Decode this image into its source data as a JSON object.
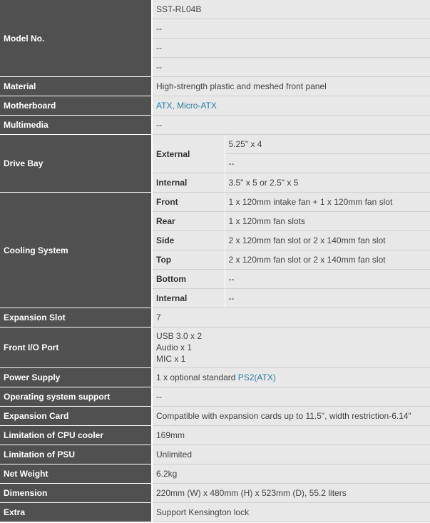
{
  "model": {
    "label": "Model No.",
    "values": [
      "SST-RL04B",
      "--",
      "--",
      "--"
    ]
  },
  "material": {
    "label": "Material",
    "value": "High-strength plastic and meshed front panel"
  },
  "motherboard": {
    "label": "Motherboard",
    "value": "ATX, Micro-ATX"
  },
  "multimedia": {
    "label": "Multimedia",
    "value": "--"
  },
  "drive_bay": {
    "label": "Drive Bay",
    "external_label": "External",
    "external_values": [
      "5.25\" x 4",
      "--"
    ],
    "internal_label": "Internal",
    "internal_value": "3.5\" x 5 or 2.5\" x 5"
  },
  "cooling": {
    "label": "Cooling System",
    "rows": [
      {
        "name": "Front",
        "value": "1 x 120mm intake fan + 1 x 120mm fan slot"
      },
      {
        "name": "Rear",
        "value": "1 x 120mm fan slots"
      },
      {
        "name": "Side",
        "value": "2 x 120mm fan slot or 2 x 140mm fan slot"
      },
      {
        "name": "Top",
        "value": "2 x 120mm fan slot or 2 x 140mm fan slot"
      },
      {
        "name": "Bottom",
        "value": "--"
      },
      {
        "name": "Internal",
        "value": "--"
      }
    ]
  },
  "expansion_slot": {
    "label": "Expansion Slot",
    "value": "7"
  },
  "front_io": {
    "label": "Front I/O Port",
    "lines": [
      "USB 3.0 x 2",
      "Audio x 1",
      "MIC x 1"
    ]
  },
  "power_supply": {
    "label": "Power Supply",
    "prefix": "1 x optional standard ",
    "link": "PS2(ATX)"
  },
  "os_support": {
    "label": "Operating system support",
    "value": "--"
  },
  "expansion_card": {
    "label": "Expansion Card",
    "value": "Compatible with expansion cards up to 11.5\", width restriction-6.14\""
  },
  "cpu_cooler": {
    "label": "Limitation of CPU cooler",
    "value": "169mm"
  },
  "psu_limit": {
    "label": "Limitation of PSU",
    "value": "Unlimited"
  },
  "net_weight": {
    "label": "Net Weight",
    "value": "6.2kg"
  },
  "dimension": {
    "label": "Dimension",
    "value": "220mm (W) x 480mm (H) x 523mm (D), 55.2 liters"
  },
  "extra": {
    "label": "Extra",
    "value": "Support Kensington lock"
  },
  "colors": {
    "header_bg": "#505050",
    "value_bg": "#e8e8e8",
    "link": "#2a7fa6"
  }
}
